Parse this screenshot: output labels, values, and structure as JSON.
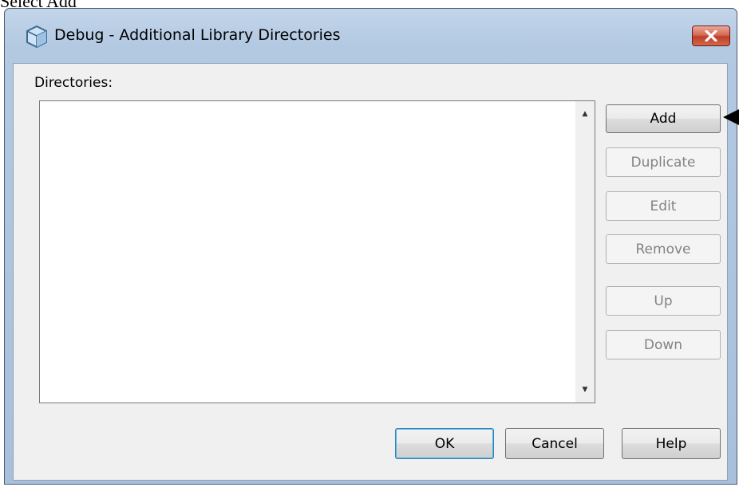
{
  "caption": "Select Add",
  "dialog": {
    "title": "Debug - Additional Library Directories",
    "close_icon": "close-icon"
  },
  "directories": {
    "label": "Directories:",
    "items": []
  },
  "side_buttons": {
    "add": "Add",
    "duplicate": "Duplicate",
    "edit": "Edit",
    "remove": "Remove",
    "up": "Up",
    "down": "Down"
  },
  "footer": {
    "ok": "OK",
    "cancel": "Cancel",
    "help": "Help"
  },
  "colors": {
    "titlebar": "#b3c9e2",
    "close_button": "#c03f27",
    "default_button_border": "#3c7fb1"
  }
}
